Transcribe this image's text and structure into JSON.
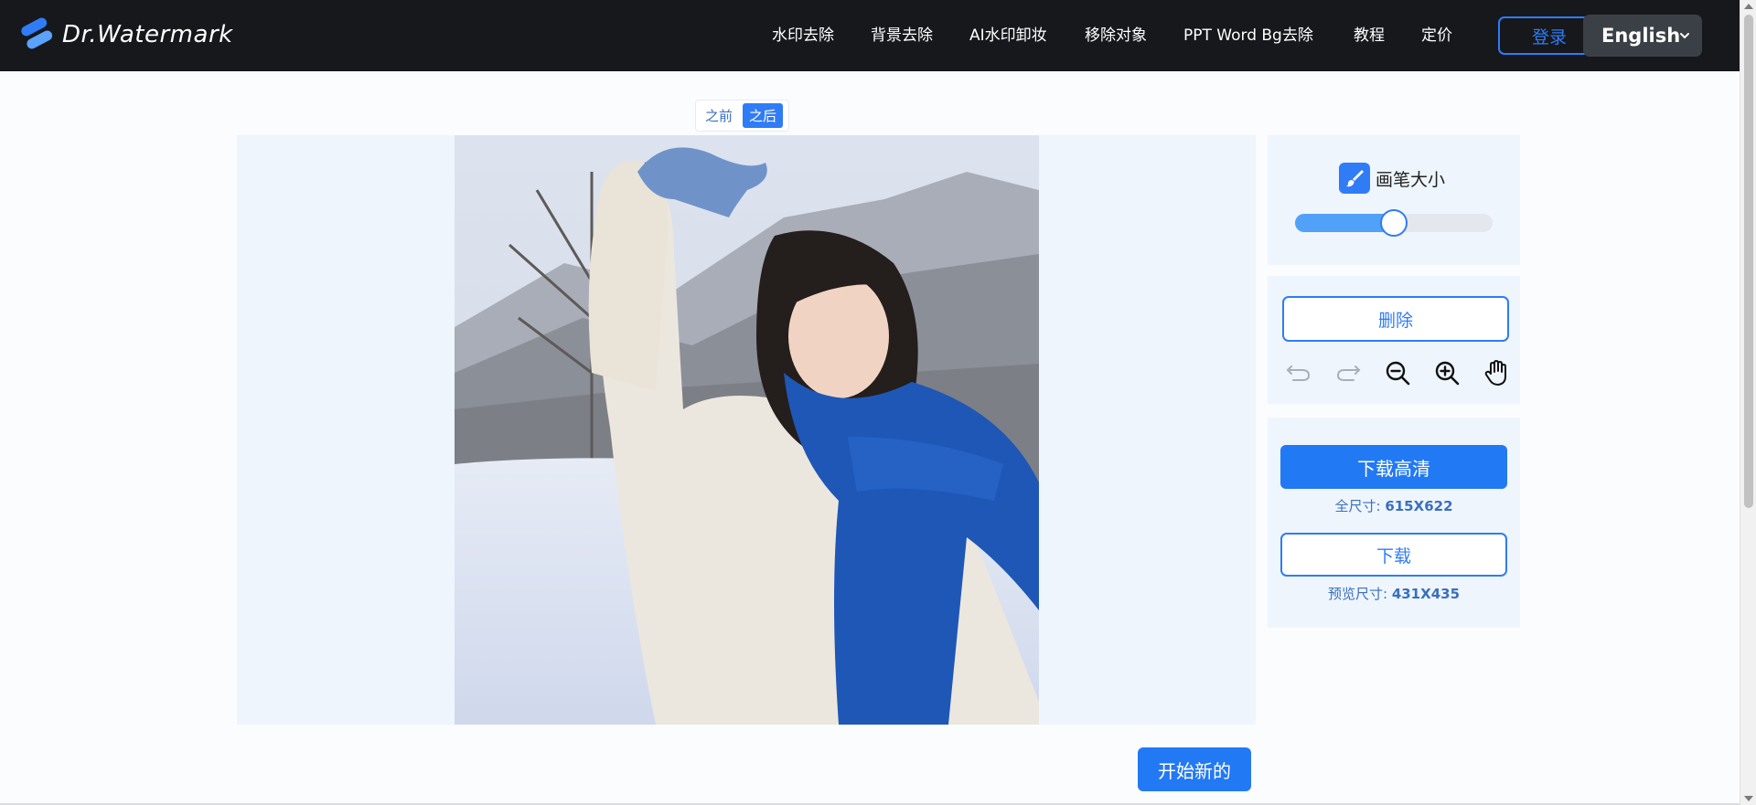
{
  "header": {
    "logo_text": "Dr.Watermark",
    "nav": [
      {
        "label": "水印去除"
      },
      {
        "label": "背景去除"
      },
      {
        "label": "AI水印卸妆"
      },
      {
        "label": "移除对象"
      },
      {
        "label": "PPT Word Bg去除"
      },
      {
        "label": "教程"
      },
      {
        "label": "定价"
      }
    ],
    "login_label": "登录",
    "language": "English"
  },
  "toggle": {
    "before_label": "之前",
    "after_label": "之后",
    "active": "after"
  },
  "brush": {
    "label": "画笔大小",
    "value_fraction": 0.5
  },
  "edit": {
    "delete_label": "删除",
    "tools": [
      "undo-icon",
      "redo-icon",
      "zoom-out-icon",
      "zoom-in-icon",
      "hand-icon"
    ]
  },
  "download": {
    "hd_label": "下载高清",
    "full_size_label": "全尺寸: ",
    "full_size_value": "615X622",
    "download_label": "下载",
    "preview_size_label": "预览尺寸: ",
    "preview_size_value": "431X435"
  },
  "start_new_label": "开始新的",
  "colors": {
    "accent": "#2279f4",
    "nav_bg": "#16181c",
    "panel_bg": "#eef5fd"
  }
}
